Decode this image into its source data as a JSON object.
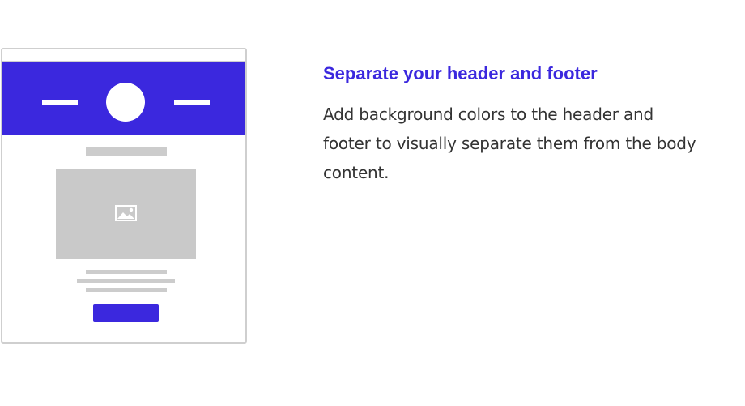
{
  "colors": {
    "accent": "#3b28de",
    "placeholder_gray": "#cccccc",
    "frame_border": "#cfcfcf",
    "body_text": "#333333"
  },
  "illustration": {
    "image_placeholder_icon": "image-icon"
  },
  "content": {
    "title": "Separate your header and footer",
    "description": "Add background colors to the header and footer to visually separate them from the body content."
  }
}
